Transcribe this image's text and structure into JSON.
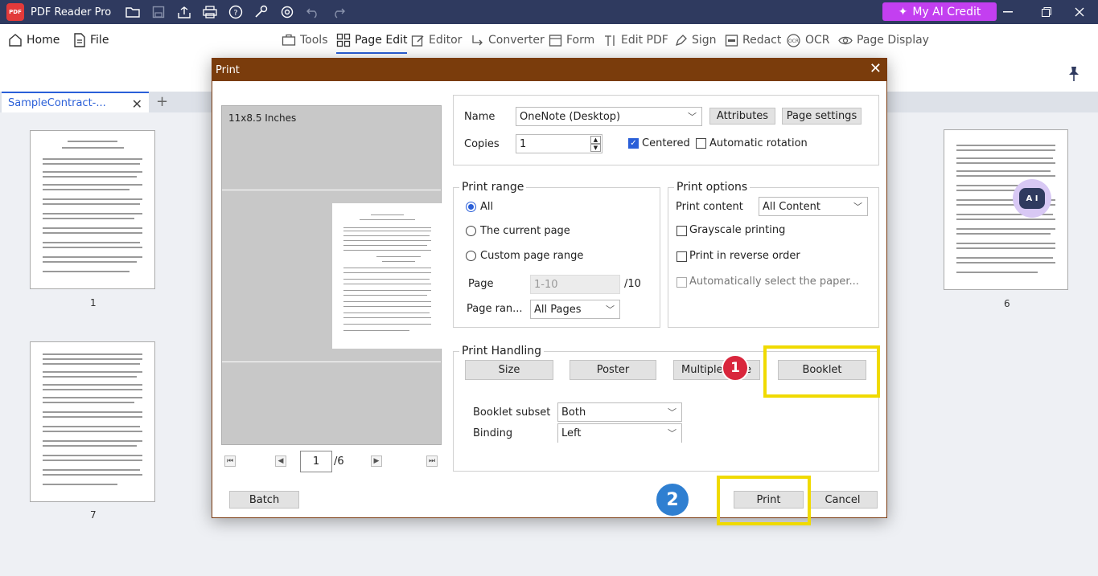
{
  "app": {
    "name": "PDF Reader Pro",
    "logo_text": "PDF",
    "ai_credit": "My AI Credit"
  },
  "nav": {
    "home": "Home",
    "file": "File"
  },
  "toolbar": {
    "tools": "Tools",
    "page_edit": "Page Edit",
    "editor": "Editor",
    "converter": "Converter",
    "form": "Form",
    "edit_pdf": "Edit PDF",
    "sign": "Sign",
    "redact": "Redact",
    "ocr": "OCR",
    "page_display": "Page Display"
  },
  "tab": {
    "title": "SampleContract-..."
  },
  "thumbnails": {
    "left_top": "1",
    "left_bottom": "7",
    "right_top": "6"
  },
  "dialog": {
    "title": "Print",
    "preview_size": "11x8.5 Inches",
    "current_page": "1",
    "total_pages": "/6",
    "printer": {
      "name_label": "Name",
      "name_value": "OneNote (Desktop)",
      "attributes": "Attributes",
      "page_settings": "Page settings",
      "copies_label": "Copies",
      "copies_value": "1",
      "centered": "Centered",
      "auto_rotation": "Automatic rotation"
    },
    "print_range": {
      "title": "Print range",
      "all": "All",
      "current": "The current page",
      "custom": "Custom page range",
      "page_label": "Page",
      "page_value": "1-10",
      "page_total": "/10",
      "page_range_label": "Page ran...",
      "page_range_value": "All Pages"
    },
    "print_options": {
      "title": "Print options",
      "content_label": "Print content",
      "content_value": "All Content",
      "grayscale": "Grayscale printing",
      "reverse": "Print in reverse order",
      "auto_paper": "Automatically select the paper..."
    },
    "handling": {
      "title": "Print Handling",
      "size": "Size",
      "poster": "Poster",
      "multiple": "Multiple",
      "multiple_tail": "e",
      "booklet": "Booklet",
      "subset_label": "Booklet subset",
      "subset_value": "Both",
      "binding_label": "Binding",
      "binding_value": "Left"
    },
    "buttons": {
      "batch": "Batch",
      "print": "Print",
      "cancel": "Cancel"
    },
    "steps": {
      "one": "1",
      "two": "2"
    }
  },
  "colors": {
    "title_bar": "#2f3a5f",
    "dialog_title": "#7a3c0c",
    "accent": "#2a5fd8",
    "ai_credit": "#c33ff0",
    "highlight": "#f0da00",
    "step_one": "#d9263c",
    "step_two": "#2f7fd1"
  }
}
